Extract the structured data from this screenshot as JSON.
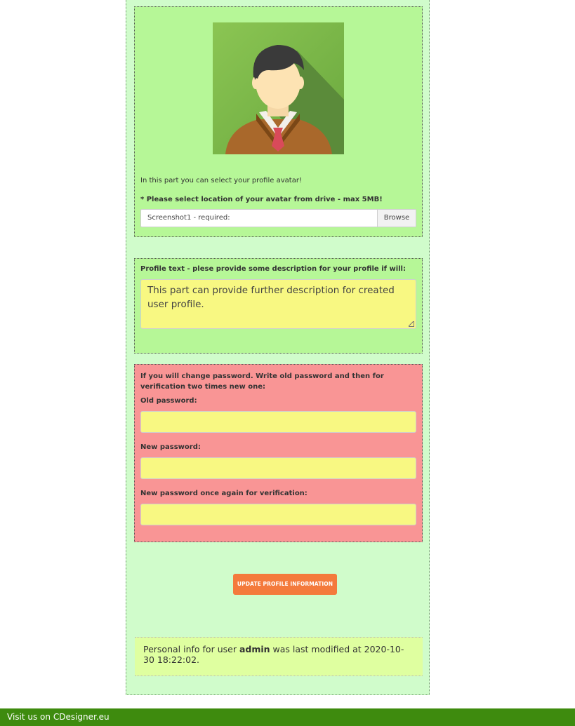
{
  "avatar_panel": {
    "avatar_alt": "default-user-avatar",
    "hint": "In this part you can select your profile avatar!",
    "requirement": "* Please select location of your avatar from drive - max 5MB!",
    "file_value": "Screenshot1 - required:",
    "browse_label": "Browse"
  },
  "profile_text_panel": {
    "label": "Profile text - plese provide some description for your profile if will:",
    "value": "This part can provide further description for created user profile."
  },
  "password_panel": {
    "intro": "If you will change password. Write old password and then for verification two times new one:",
    "old_label": "Old password:",
    "new_label": "New password:",
    "verify_label": "New password once again for verification:",
    "old_value": "",
    "new_value": "",
    "verify_value": ""
  },
  "update_button_label": "UPDATE PROFILE INFORMATION",
  "info": {
    "prefix": "Personal info for user ",
    "user": "admin",
    "suffix": " was last modified at 2020-10-30 18:22:02."
  },
  "footer": {
    "text": "Visit us on CDesigner.eu"
  },
  "colors": {
    "panel_green": "#b6f797",
    "page_green": "#d0fccb",
    "password_red": "#f99595",
    "input_yellow": "#f8f882",
    "button_orange": "#f47a3c",
    "footer_green": "#3e8b0e"
  }
}
